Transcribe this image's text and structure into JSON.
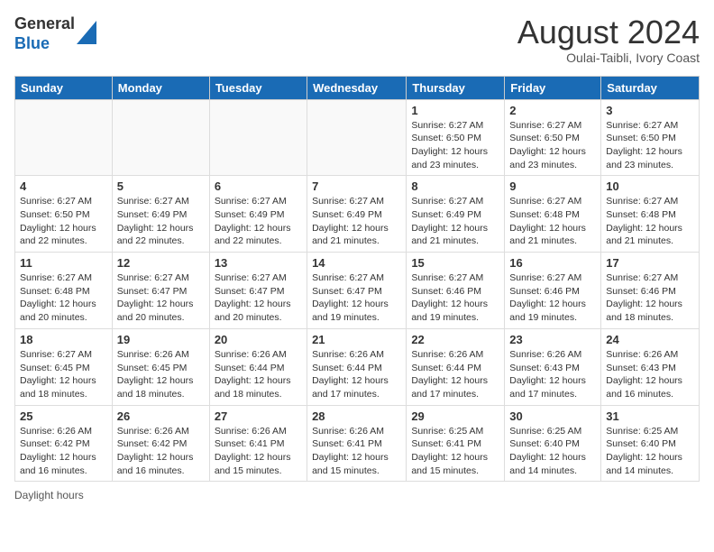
{
  "header": {
    "logo_general": "General",
    "logo_blue": "Blue",
    "month_title": "August 2024",
    "subtitle": "Oulai-Taibli, Ivory Coast"
  },
  "days_of_week": [
    "Sunday",
    "Monday",
    "Tuesday",
    "Wednesday",
    "Thursday",
    "Friday",
    "Saturday"
  ],
  "weeks": [
    [
      {
        "day": "",
        "info": ""
      },
      {
        "day": "",
        "info": ""
      },
      {
        "day": "",
        "info": ""
      },
      {
        "day": "",
        "info": ""
      },
      {
        "day": "1",
        "info": "Sunrise: 6:27 AM\nSunset: 6:50 PM\nDaylight: 12 hours and 23 minutes."
      },
      {
        "day": "2",
        "info": "Sunrise: 6:27 AM\nSunset: 6:50 PM\nDaylight: 12 hours and 23 minutes."
      },
      {
        "day": "3",
        "info": "Sunrise: 6:27 AM\nSunset: 6:50 PM\nDaylight: 12 hours and 23 minutes."
      }
    ],
    [
      {
        "day": "4",
        "info": "Sunrise: 6:27 AM\nSunset: 6:50 PM\nDaylight: 12 hours and 22 minutes."
      },
      {
        "day": "5",
        "info": "Sunrise: 6:27 AM\nSunset: 6:49 PM\nDaylight: 12 hours and 22 minutes."
      },
      {
        "day": "6",
        "info": "Sunrise: 6:27 AM\nSunset: 6:49 PM\nDaylight: 12 hours and 22 minutes."
      },
      {
        "day": "7",
        "info": "Sunrise: 6:27 AM\nSunset: 6:49 PM\nDaylight: 12 hours and 21 minutes."
      },
      {
        "day": "8",
        "info": "Sunrise: 6:27 AM\nSunset: 6:49 PM\nDaylight: 12 hours and 21 minutes."
      },
      {
        "day": "9",
        "info": "Sunrise: 6:27 AM\nSunset: 6:48 PM\nDaylight: 12 hours and 21 minutes."
      },
      {
        "day": "10",
        "info": "Sunrise: 6:27 AM\nSunset: 6:48 PM\nDaylight: 12 hours and 21 minutes."
      }
    ],
    [
      {
        "day": "11",
        "info": "Sunrise: 6:27 AM\nSunset: 6:48 PM\nDaylight: 12 hours and 20 minutes."
      },
      {
        "day": "12",
        "info": "Sunrise: 6:27 AM\nSunset: 6:47 PM\nDaylight: 12 hours and 20 minutes."
      },
      {
        "day": "13",
        "info": "Sunrise: 6:27 AM\nSunset: 6:47 PM\nDaylight: 12 hours and 20 minutes."
      },
      {
        "day": "14",
        "info": "Sunrise: 6:27 AM\nSunset: 6:47 PM\nDaylight: 12 hours and 19 minutes."
      },
      {
        "day": "15",
        "info": "Sunrise: 6:27 AM\nSunset: 6:46 PM\nDaylight: 12 hours and 19 minutes."
      },
      {
        "day": "16",
        "info": "Sunrise: 6:27 AM\nSunset: 6:46 PM\nDaylight: 12 hours and 19 minutes."
      },
      {
        "day": "17",
        "info": "Sunrise: 6:27 AM\nSunset: 6:46 PM\nDaylight: 12 hours and 18 minutes."
      }
    ],
    [
      {
        "day": "18",
        "info": "Sunrise: 6:27 AM\nSunset: 6:45 PM\nDaylight: 12 hours and 18 minutes."
      },
      {
        "day": "19",
        "info": "Sunrise: 6:26 AM\nSunset: 6:45 PM\nDaylight: 12 hours and 18 minutes."
      },
      {
        "day": "20",
        "info": "Sunrise: 6:26 AM\nSunset: 6:44 PM\nDaylight: 12 hours and 18 minutes."
      },
      {
        "day": "21",
        "info": "Sunrise: 6:26 AM\nSunset: 6:44 PM\nDaylight: 12 hours and 17 minutes."
      },
      {
        "day": "22",
        "info": "Sunrise: 6:26 AM\nSunset: 6:44 PM\nDaylight: 12 hours and 17 minutes."
      },
      {
        "day": "23",
        "info": "Sunrise: 6:26 AM\nSunset: 6:43 PM\nDaylight: 12 hours and 17 minutes."
      },
      {
        "day": "24",
        "info": "Sunrise: 6:26 AM\nSunset: 6:43 PM\nDaylight: 12 hours and 16 minutes."
      }
    ],
    [
      {
        "day": "25",
        "info": "Sunrise: 6:26 AM\nSunset: 6:42 PM\nDaylight: 12 hours and 16 minutes."
      },
      {
        "day": "26",
        "info": "Sunrise: 6:26 AM\nSunset: 6:42 PM\nDaylight: 12 hours and 16 minutes."
      },
      {
        "day": "27",
        "info": "Sunrise: 6:26 AM\nSunset: 6:41 PM\nDaylight: 12 hours and 15 minutes."
      },
      {
        "day": "28",
        "info": "Sunrise: 6:26 AM\nSunset: 6:41 PM\nDaylight: 12 hours and 15 minutes."
      },
      {
        "day": "29",
        "info": "Sunrise: 6:25 AM\nSunset: 6:41 PM\nDaylight: 12 hours and 15 minutes."
      },
      {
        "day": "30",
        "info": "Sunrise: 6:25 AM\nSunset: 6:40 PM\nDaylight: 12 hours and 14 minutes."
      },
      {
        "day": "31",
        "info": "Sunrise: 6:25 AM\nSunset: 6:40 PM\nDaylight: 12 hours and 14 minutes."
      }
    ]
  ],
  "legend": {
    "daylight_label": "Daylight hours"
  }
}
